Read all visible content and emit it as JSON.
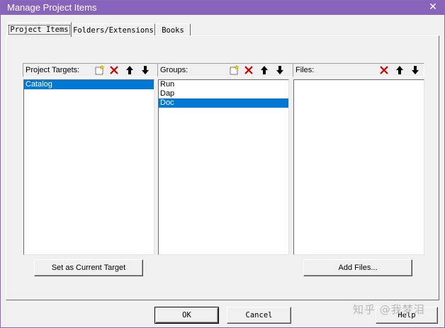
{
  "window": {
    "title": "Manage Project Items",
    "close_glyph": "✕"
  },
  "tabs": [
    {
      "label": "Project Items",
      "active": true
    },
    {
      "label": "Folders/Extensions",
      "active": false
    },
    {
      "label": "Books",
      "active": false
    }
  ],
  "targets": {
    "label": "Project Targets:",
    "items": [
      {
        "text": "Catalog",
        "selected": true
      }
    ],
    "button_label": "Set as Current Target",
    "toolbar": [
      "new-icon",
      "delete-icon",
      "move-up-icon",
      "move-down-icon"
    ]
  },
  "groups": {
    "label": "Groups:",
    "items": [
      {
        "text": "Run",
        "selected": false
      },
      {
        "text": "Dap",
        "selected": false
      },
      {
        "text": "Doc",
        "selected": true
      }
    ],
    "toolbar": [
      "new-icon",
      "delete-icon",
      "move-up-icon",
      "move-down-icon"
    ]
  },
  "files": {
    "label": "Files:",
    "items": [],
    "button_label": "Add Files...",
    "toolbar": [
      "delete-icon",
      "move-up-icon",
      "move-down-icon"
    ]
  },
  "footer": {
    "ok_label": "OK",
    "cancel_label": "Cancel",
    "help_label": "Help"
  },
  "watermark": "知乎 @我梦泪",
  "colors": {
    "titlebar": "#8864bd",
    "selection": "#0078d7",
    "delete_x": "#cc0000",
    "new_icon_yellow": "#f5d400"
  }
}
